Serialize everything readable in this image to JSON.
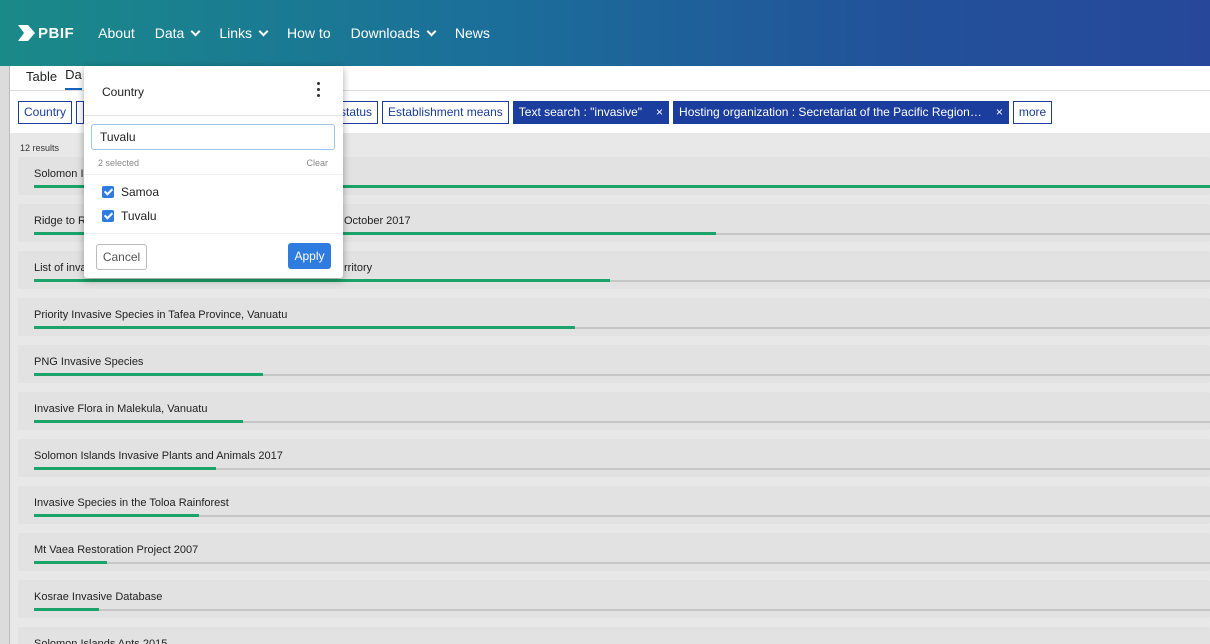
{
  "nav": {
    "logo_text": "PBIF",
    "items": [
      {
        "label": "About",
        "dropdown": false
      },
      {
        "label": "Data",
        "dropdown": true
      },
      {
        "label": "Links",
        "dropdown": true
      },
      {
        "label": "How to",
        "dropdown": false
      },
      {
        "label": "Downloads",
        "dropdown": true
      },
      {
        "label": "News",
        "dropdown": false
      }
    ]
  },
  "tabs": [
    {
      "label": "Table",
      "active": false
    },
    {
      "label": "Da",
      "active": true
    }
  ],
  "filters": {
    "chips": [
      {
        "label": "Country",
        "filled": false
      },
      {
        "label": "status",
        "filled": false
      },
      {
        "label": "Establishment means",
        "filled": false
      },
      {
        "label": "Text search : \"invasive\"",
        "filled": true,
        "close": "×"
      },
      {
        "label": "Hosting organization : Secretariat of the Pacific Region…",
        "filled": true,
        "close": "×"
      },
      {
        "label": "more",
        "filled": false
      }
    ]
  },
  "results": {
    "count_label": "12 results",
    "items": [
      {
        "title": "Solomon I",
        "fraction": 1.0
      },
      {
        "title": "Ridge to R",
        "title_suffix": "October 2017",
        "fraction": 0.58
      },
      {
        "title": "List of inva",
        "title_suffix": "rritory",
        "fraction": 0.49
      },
      {
        "title": "Priority Invasive Species in Tafea Province, Vanuatu",
        "fraction": 0.46
      },
      {
        "title": "PNG Invasive Species",
        "fraction": 0.195
      },
      {
        "title": "Invasive Flora in Malekula, Vanuatu",
        "fraction": 0.178
      },
      {
        "title": "Solomon Islands Invasive Plants and Animals 2017",
        "fraction": 0.155
      },
      {
        "title": "Invasive Species in the Toloa Rainforest",
        "fraction": 0.14
      },
      {
        "title": "Mt Vaea Restoration Project 2007",
        "fraction": 0.062
      },
      {
        "title": "Kosrae Invasive Database",
        "fraction": 0.055
      },
      {
        "title": "Solomon Islands Ants 2015",
        "fraction": 0.03
      }
    ]
  },
  "popup": {
    "title": "Country",
    "search_value": "Tuvalu",
    "selected_label": "2 selected",
    "clear_label": "Clear",
    "options": [
      {
        "label": "Samoa",
        "checked": true
      },
      {
        "label": "Tuvalu",
        "checked": true
      }
    ],
    "cancel_label": "Cancel",
    "apply_label": "Apply"
  },
  "colors": {
    "accent": "#1a3d9e",
    "progress": "#1aa36a",
    "apply": "#2f7ce0"
  }
}
